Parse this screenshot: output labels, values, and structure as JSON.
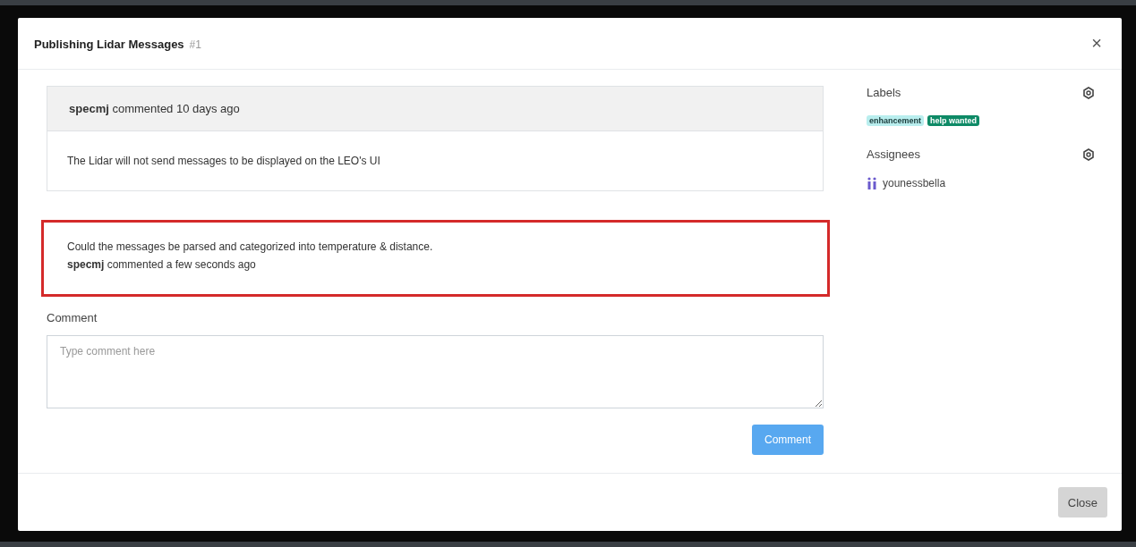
{
  "modal": {
    "title": "Publishing Lidar Messages",
    "number": "#1",
    "close": "×"
  },
  "comments": [
    {
      "header": "**specmj** commented 10 days ago",
      "body": "The Lidar will not send messages to be displayed on the LEO's UI"
    }
  ],
  "new_comment": {
    "body": "Could the messages be parsed and categorized into temperature & distance.",
    "meta": "**specmj** commented a few seconds ago"
  },
  "comment_form": {
    "label": "Comment",
    "placeholder": "Type comment here",
    "submit": "Comment"
  },
  "sidebar": {
    "labels_title": "Labels",
    "labels": [
      {
        "name": "enhancement",
        "color": "#b9eeee"
      },
      {
        "name": "help wanted",
        "color": "#0e8a66"
      }
    ],
    "assignees_title": "Assignees",
    "assignees": [
      "younessbella"
    ]
  },
  "footer": {
    "close": "Close"
  }
}
